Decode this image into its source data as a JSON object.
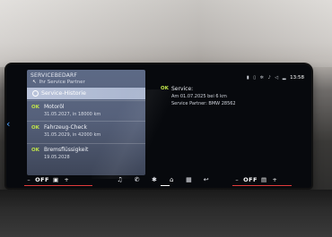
{
  "panel": {
    "title": "SERVICEBEDARF",
    "subtitle": "Ihr Service Partner",
    "items": [
      {
        "status": "",
        "label": "Service-Historie",
        "detail": ""
      },
      {
        "status": "OK",
        "label": "Motoröl",
        "detail": "31.05.2027, in 18000 km"
      },
      {
        "status": "OK",
        "label": "Fahrzeug-Check",
        "detail": "31.05.2029, in 42000 km"
      },
      {
        "status": "OK",
        "label": "Bremsflüssigkeit",
        "detail": "19.05.2028"
      }
    ]
  },
  "service": {
    "status": "OK",
    "title": "Service:",
    "line1": "Am 01.07.2025 bei 6 km",
    "line2": "Service Partner: BMW 28562"
  },
  "statusbar": {
    "time": "13:58"
  },
  "climate": {
    "left": {
      "minus": "–",
      "state": "OFF",
      "plus": "+"
    },
    "right": {
      "minus": "–",
      "state": "OFF",
      "plus": "+"
    }
  },
  "nav": {
    "icons": [
      "music-icon",
      "phone-icon",
      "apps-icon",
      "home-icon",
      "grid-icon",
      "route-icon"
    ],
    "glyphs": [
      "♫",
      "✆",
      "✱",
      "⌂",
      "▦",
      "↩"
    ]
  },
  "colors": {
    "ok": "#bfe34a",
    "panel": "#56617b",
    "accent": "#e23b3b"
  }
}
